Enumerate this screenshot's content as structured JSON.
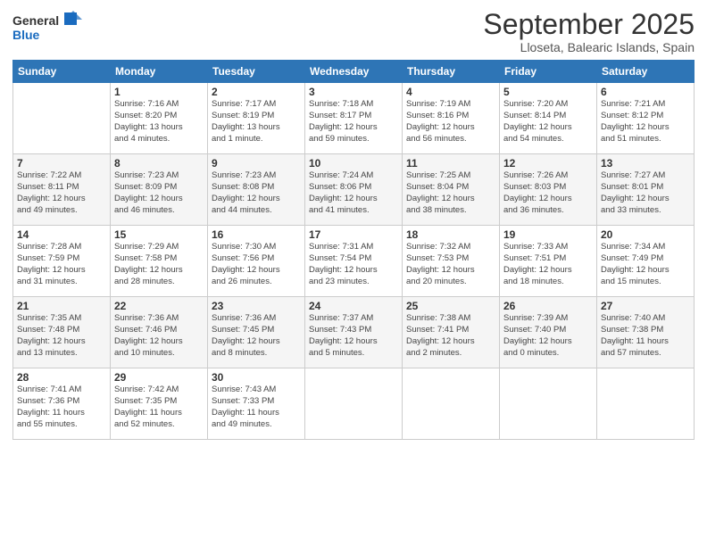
{
  "logo": {
    "general": "General",
    "blue": "Blue"
  },
  "header": {
    "title": "September 2025",
    "subtitle": "Lloseta, Balearic Islands, Spain"
  },
  "days_of_week": [
    "Sunday",
    "Monday",
    "Tuesday",
    "Wednesday",
    "Thursday",
    "Friday",
    "Saturday"
  ],
  "weeks": [
    [
      {
        "num": "",
        "info": ""
      },
      {
        "num": "1",
        "info": "Sunrise: 7:16 AM\nSunset: 8:20 PM\nDaylight: 13 hours\nand 4 minutes."
      },
      {
        "num": "2",
        "info": "Sunrise: 7:17 AM\nSunset: 8:19 PM\nDaylight: 13 hours\nand 1 minute."
      },
      {
        "num": "3",
        "info": "Sunrise: 7:18 AM\nSunset: 8:17 PM\nDaylight: 12 hours\nand 59 minutes."
      },
      {
        "num": "4",
        "info": "Sunrise: 7:19 AM\nSunset: 8:16 PM\nDaylight: 12 hours\nand 56 minutes."
      },
      {
        "num": "5",
        "info": "Sunrise: 7:20 AM\nSunset: 8:14 PM\nDaylight: 12 hours\nand 54 minutes."
      },
      {
        "num": "6",
        "info": "Sunrise: 7:21 AM\nSunset: 8:12 PM\nDaylight: 12 hours\nand 51 minutes."
      }
    ],
    [
      {
        "num": "7",
        "info": "Sunrise: 7:22 AM\nSunset: 8:11 PM\nDaylight: 12 hours\nand 49 minutes."
      },
      {
        "num": "8",
        "info": "Sunrise: 7:23 AM\nSunset: 8:09 PM\nDaylight: 12 hours\nand 46 minutes."
      },
      {
        "num": "9",
        "info": "Sunrise: 7:23 AM\nSunset: 8:08 PM\nDaylight: 12 hours\nand 44 minutes."
      },
      {
        "num": "10",
        "info": "Sunrise: 7:24 AM\nSunset: 8:06 PM\nDaylight: 12 hours\nand 41 minutes."
      },
      {
        "num": "11",
        "info": "Sunrise: 7:25 AM\nSunset: 8:04 PM\nDaylight: 12 hours\nand 38 minutes."
      },
      {
        "num": "12",
        "info": "Sunrise: 7:26 AM\nSunset: 8:03 PM\nDaylight: 12 hours\nand 36 minutes."
      },
      {
        "num": "13",
        "info": "Sunrise: 7:27 AM\nSunset: 8:01 PM\nDaylight: 12 hours\nand 33 minutes."
      }
    ],
    [
      {
        "num": "14",
        "info": "Sunrise: 7:28 AM\nSunset: 7:59 PM\nDaylight: 12 hours\nand 31 minutes."
      },
      {
        "num": "15",
        "info": "Sunrise: 7:29 AM\nSunset: 7:58 PM\nDaylight: 12 hours\nand 28 minutes."
      },
      {
        "num": "16",
        "info": "Sunrise: 7:30 AM\nSunset: 7:56 PM\nDaylight: 12 hours\nand 26 minutes."
      },
      {
        "num": "17",
        "info": "Sunrise: 7:31 AM\nSunset: 7:54 PM\nDaylight: 12 hours\nand 23 minutes."
      },
      {
        "num": "18",
        "info": "Sunrise: 7:32 AM\nSunset: 7:53 PM\nDaylight: 12 hours\nand 20 minutes."
      },
      {
        "num": "19",
        "info": "Sunrise: 7:33 AM\nSunset: 7:51 PM\nDaylight: 12 hours\nand 18 minutes."
      },
      {
        "num": "20",
        "info": "Sunrise: 7:34 AM\nSunset: 7:49 PM\nDaylight: 12 hours\nand 15 minutes."
      }
    ],
    [
      {
        "num": "21",
        "info": "Sunrise: 7:35 AM\nSunset: 7:48 PM\nDaylight: 12 hours\nand 13 minutes."
      },
      {
        "num": "22",
        "info": "Sunrise: 7:36 AM\nSunset: 7:46 PM\nDaylight: 12 hours\nand 10 minutes."
      },
      {
        "num": "23",
        "info": "Sunrise: 7:36 AM\nSunset: 7:45 PM\nDaylight: 12 hours\nand 8 minutes."
      },
      {
        "num": "24",
        "info": "Sunrise: 7:37 AM\nSunset: 7:43 PM\nDaylight: 12 hours\nand 5 minutes."
      },
      {
        "num": "25",
        "info": "Sunrise: 7:38 AM\nSunset: 7:41 PM\nDaylight: 12 hours\nand 2 minutes."
      },
      {
        "num": "26",
        "info": "Sunrise: 7:39 AM\nSunset: 7:40 PM\nDaylight: 12 hours\nand 0 minutes."
      },
      {
        "num": "27",
        "info": "Sunrise: 7:40 AM\nSunset: 7:38 PM\nDaylight: 11 hours\nand 57 minutes."
      }
    ],
    [
      {
        "num": "28",
        "info": "Sunrise: 7:41 AM\nSunset: 7:36 PM\nDaylight: 11 hours\nand 55 minutes."
      },
      {
        "num": "29",
        "info": "Sunrise: 7:42 AM\nSunset: 7:35 PM\nDaylight: 11 hours\nand 52 minutes."
      },
      {
        "num": "30",
        "info": "Sunrise: 7:43 AM\nSunset: 7:33 PM\nDaylight: 11 hours\nand 49 minutes."
      },
      {
        "num": "",
        "info": ""
      },
      {
        "num": "",
        "info": ""
      },
      {
        "num": "",
        "info": ""
      },
      {
        "num": "",
        "info": ""
      }
    ]
  ]
}
